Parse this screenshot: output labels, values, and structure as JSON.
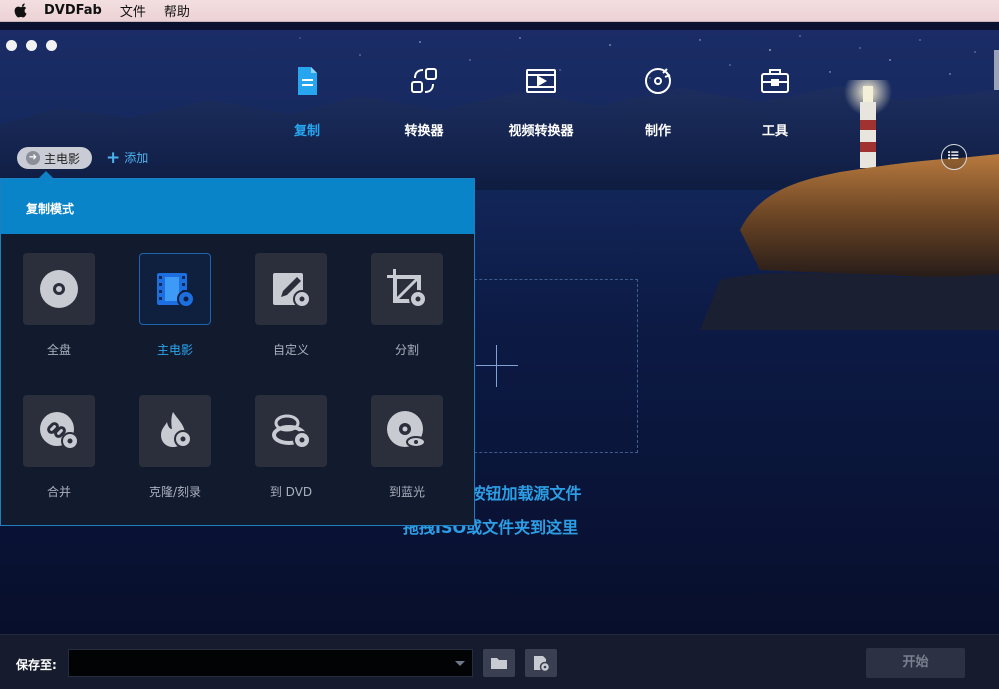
{
  "menubar": {
    "app_name": "DVDFab",
    "menu_file": "文件",
    "menu_help": "帮助"
  },
  "toolbar": {
    "tabs": [
      {
        "label": "复制",
        "icon": "copy-icon",
        "active": true
      },
      {
        "label": "转换器",
        "icon": "converter-icon",
        "active": false
      },
      {
        "label": "视频转换器",
        "icon": "video-converter-icon",
        "active": false
      },
      {
        "label": "制作",
        "icon": "creator-icon",
        "active": false
      },
      {
        "label": "工具",
        "icon": "toolbox-icon",
        "active": false
      }
    ]
  },
  "source": {
    "chip_label": "主电影",
    "add_label": "添加"
  },
  "copy_mode_panel": {
    "title": "复制模式",
    "modes": [
      {
        "label": "全盘",
        "icon": "full-disc-icon",
        "active": false
      },
      {
        "label": "主电影",
        "icon": "main-movie-icon",
        "active": true
      },
      {
        "label": "自定义",
        "icon": "customize-icon",
        "active": false
      },
      {
        "label": "分割",
        "icon": "split-icon",
        "active": false
      },
      {
        "label": "合并",
        "icon": "merge-icon",
        "active": false
      },
      {
        "label": "克隆/刻录",
        "icon": "clone-burn-icon",
        "active": false
      },
      {
        "label": "到 DVD",
        "icon": "to-dvd-icon",
        "active": false
      },
      {
        "label": "到蓝光",
        "icon": "to-bluray-icon",
        "active": false
      }
    ]
  },
  "drop_area": {
    "hint_line1": "点击“+”按钮加载源文件",
    "hint_line2": "拖拽ISO或文件夹到这里"
  },
  "bottom": {
    "save_label": "保存至:",
    "save_path": "",
    "start_label": "开始"
  },
  "colors": {
    "accent": "#27a6ef",
    "panel_header": "#0a84c8",
    "panel_bg": "#121a2e"
  }
}
